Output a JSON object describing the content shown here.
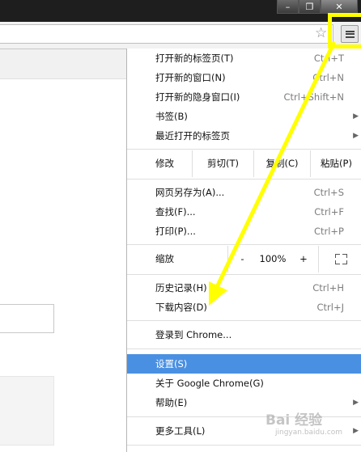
{
  "window": {
    "minimize_glyph": "–",
    "maximize_glyph": "❐",
    "close_glyph": "✕"
  },
  "toolbar": {
    "star_icon": "☆",
    "menu_icon": "hamburger-icon"
  },
  "menu": {
    "top_items": [
      {
        "label": "打开新的标签页(T)",
        "shortcut": "Ctrl+T"
      },
      {
        "label": "打开新的窗口(N)",
        "shortcut": "Ctrl+N"
      },
      {
        "label": "打开新的隐身窗口(I)",
        "shortcut": "Ctrl+Shift+N"
      },
      {
        "label": "书签(B)",
        "shortcut": ""
      },
      {
        "label": "最近打开的标签页",
        "shortcut": ""
      }
    ],
    "edit": {
      "label": "修改",
      "cut": "剪切(T)",
      "copy": "复制(C)",
      "paste": "粘贴(P)"
    },
    "page_items": [
      {
        "label": "网页另存为(A)...",
        "shortcut": "Ctrl+S"
      },
      {
        "label": "查找(F)...",
        "shortcut": "Ctrl+F"
      },
      {
        "label": "打印(P)...",
        "shortcut": "Ctrl+P"
      }
    ],
    "zoom": {
      "label": "缩放",
      "minus": "-",
      "value": "100%",
      "plus": "+"
    },
    "history_items": [
      {
        "label": "历史记录(H)",
        "shortcut": "Ctrl+H"
      },
      {
        "label": "下载内容(D)",
        "shortcut": "Ctrl+J"
      }
    ],
    "signin": {
      "label": "登录到 Chrome..."
    },
    "settings_items": [
      {
        "label": "设置(S)"
      },
      {
        "label": "关于 Google Chrome(G)"
      },
      {
        "label": "帮助(E)"
      }
    ],
    "more_tools": {
      "label": "更多工具(L)"
    }
  },
  "annotation": {
    "highlight_color": "#ffff00",
    "menu_highlight_color": "#4a90e2"
  },
  "watermark": {
    "text": "Bai 经验",
    "sub": "jingyan.baidu.com"
  }
}
